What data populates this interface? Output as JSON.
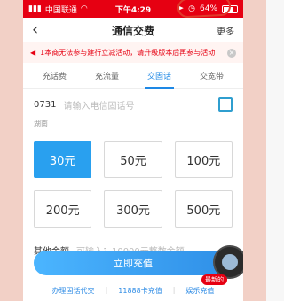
{
  "status": {
    "carrier": "中国联通",
    "wifi_icon": "wifi-icon",
    "time": "下午4:29",
    "battery_pct": "64%"
  },
  "nav": {
    "back_icon": "chevron-left-icon",
    "title": "通信交费",
    "more": "更多"
  },
  "notice": {
    "icon": "speaker-icon",
    "text": "1本商无法参与建行立减活动，请升级版本后再参与活动"
  },
  "tabs": [
    {
      "label": "充话费"
    },
    {
      "label": "充流量"
    },
    {
      "label": "交固话"
    },
    {
      "label": "交宽带"
    }
  ],
  "phone": {
    "area_code": "0731",
    "placeholder": "请输入电信固话号",
    "province": "湖南"
  },
  "amounts": [
    "30元",
    "50元",
    "100元",
    "200元",
    "300元",
    "500元"
  ],
  "other": {
    "label": "其他金额",
    "placeholder": "可输入1-10000元整数金额"
  },
  "buttons": {
    "recharge": "立即充值"
  },
  "links": {
    "proxy": "办理固话代交",
    "card": "11888卡充值",
    "entertainment": "娱乐充值",
    "new_tag": "最新的"
  }
}
